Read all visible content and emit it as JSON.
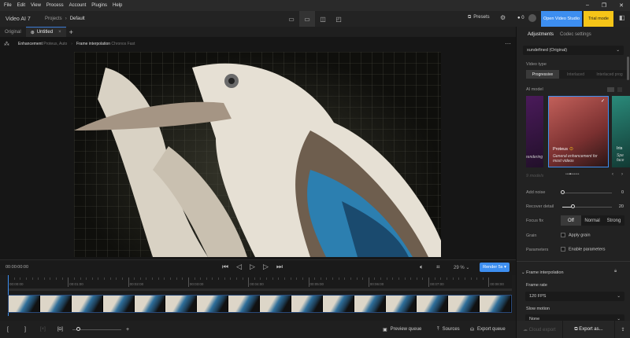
{
  "menu": [
    "File",
    "Edit",
    "View",
    "Process",
    "Account",
    "Plugins",
    "Help"
  ],
  "app": {
    "title": "Video AI 7",
    "crumb_root": "Projects",
    "crumb_current": "Default",
    "presets": "Presets",
    "credits": "0",
    "open_studio": "Open Video Studio",
    "trial": "Trial mode",
    "accent": "#3d8ef0",
    "trial_color": "#f5c518"
  },
  "tabs": [
    {
      "label": "Original"
    },
    {
      "label": "Untitled"
    }
  ],
  "pipeline": {
    "enh_label": "Enhancement",
    "enh_value": "Proteus, Auto",
    "fi_label": "Frame interpolation",
    "fi_value": "Chronos Fast"
  },
  "player": {
    "timecode": "00:00:00:00",
    "zoom": "29 %",
    "render": "Render 5s"
  },
  "ruler": [
    "00:00:00",
    "00:01:00",
    "00:02:00",
    "00:03:00",
    "00:04:00",
    "00:05:00",
    "00:06:00",
    "00:07:00",
    "00:08:00"
  ],
  "bottom": {
    "preview_queue": "Preview queue",
    "sources": "Sources",
    "export_queue": "Export queue"
  },
  "panel": {
    "tabs": [
      "Adjustments",
      "Codec settings"
    ],
    "resolution": "xundefined (Original)",
    "video_type_label": "Video type",
    "video_types": [
      "Progressive",
      "Interlaced",
      "Interlaced prog"
    ],
    "ai_model_label": "AI model",
    "model_left": "rendering",
    "model_name": "Proteus",
    "model_desc": "General enhancement for most videos",
    "model_right": "Iris",
    "model_right_desc": "Spe face",
    "models_count": "9 models",
    "add_noise_label": "Add noise",
    "add_noise": 0,
    "recover_detail_label": "Recover detail",
    "recover_detail": 20,
    "focus_fix_label": "Focus fix",
    "focus_fix": [
      "Off",
      "Normal",
      "Strong"
    ],
    "grain_label": "Grain",
    "grain_check": "Apply grain",
    "params_label": "Parameters",
    "params_check": "Enable parameters",
    "fi_section": "Frame interpolation",
    "frame_rate_label": "Frame rate",
    "frame_rate": "120 FPS",
    "slow_motion_label": "Slow motion",
    "slow_motion": "None",
    "cloud_export": "Cloud export",
    "export_as": "Export as..."
  }
}
